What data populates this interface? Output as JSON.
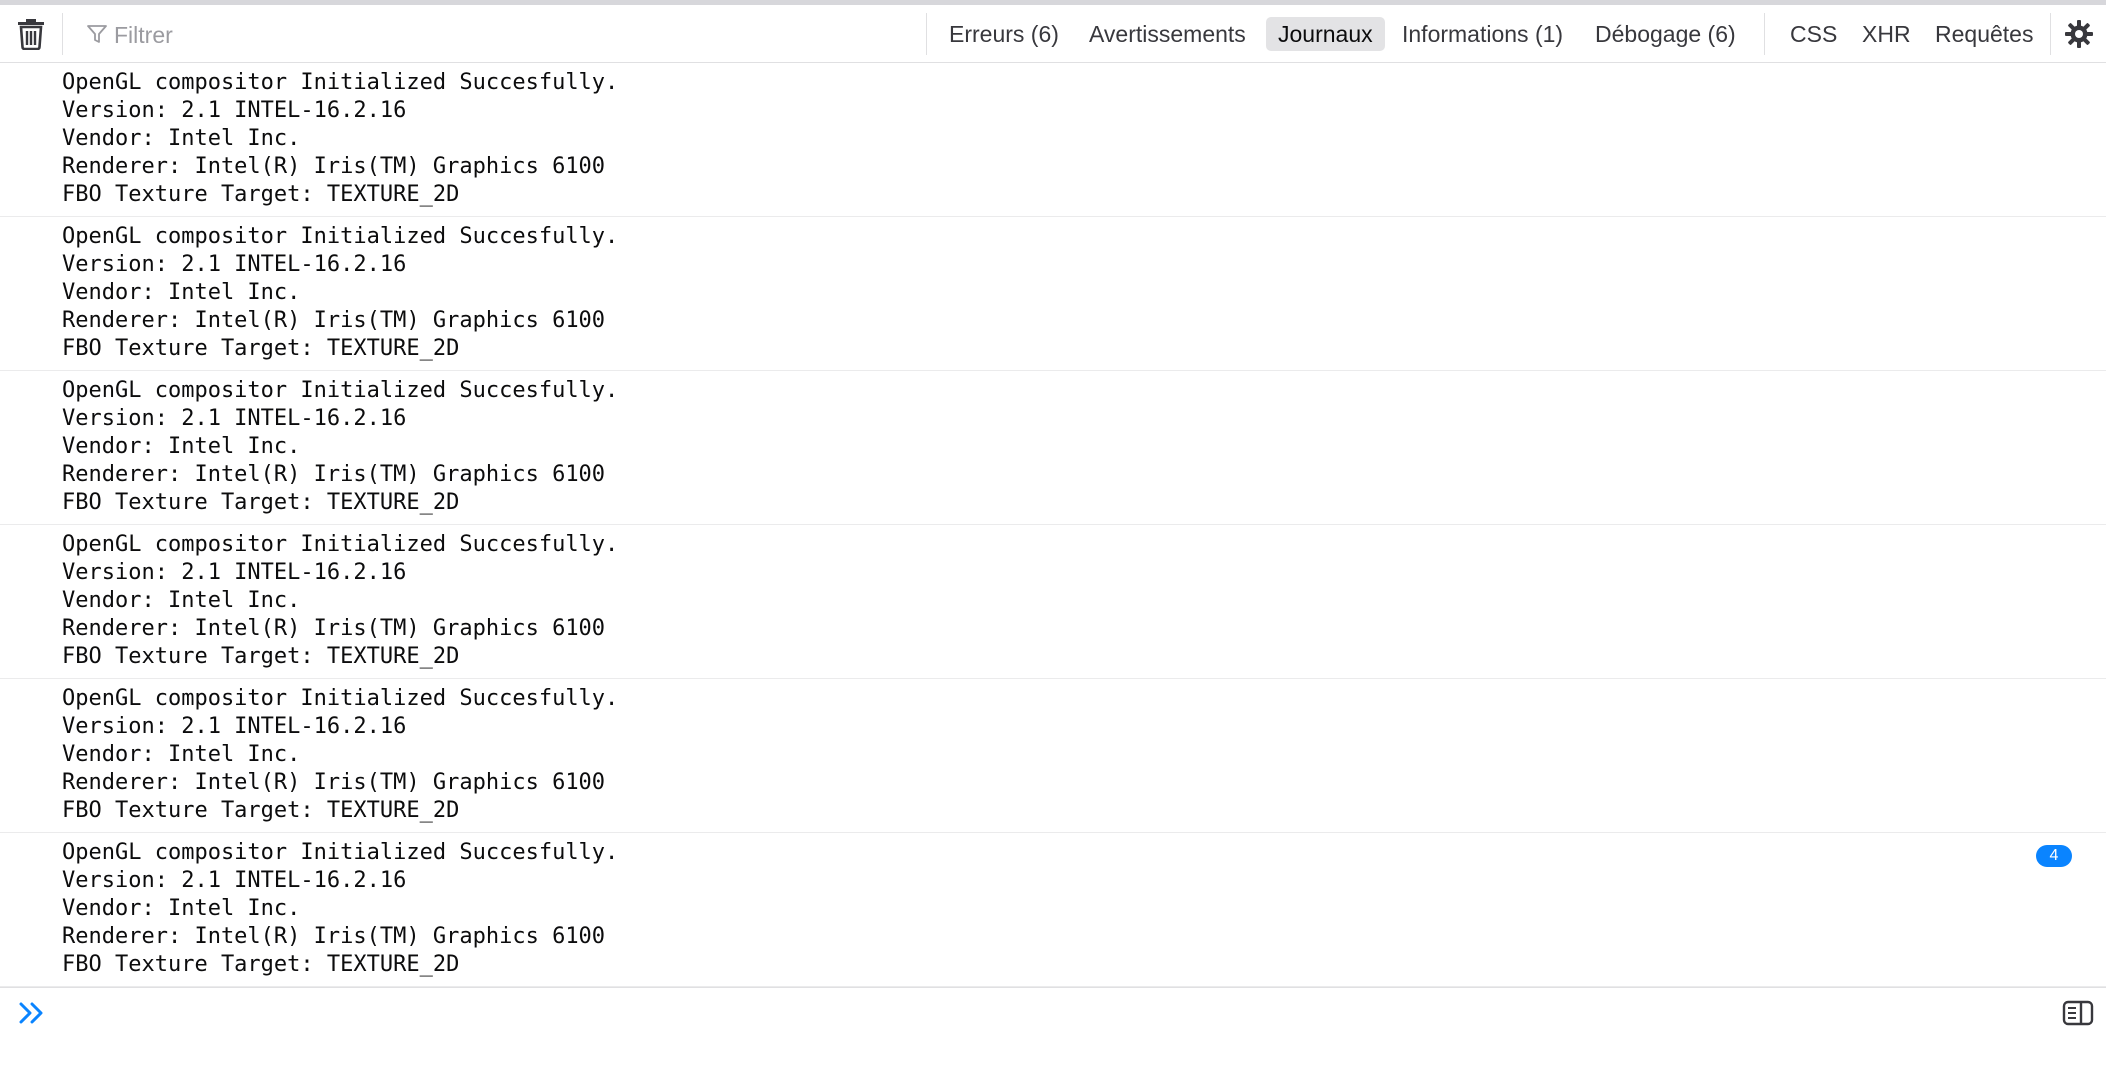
{
  "toolbar": {
    "filter_placeholder": "Filtrer",
    "filters": {
      "errors": "Erreurs (6)",
      "warnings": "Avertissements",
      "logs": "Journaux",
      "info": "Informations (1)",
      "debug": "Débogage (6)"
    },
    "request_filters": {
      "css": "CSS",
      "xhr": "XHR",
      "requests": "Requêtes"
    },
    "active_filter": "logs"
  },
  "messages": [
    {
      "lines": [
        "OpenGL compositor Initialized Succesfully.",
        "Version: 2.1 INTEL-16.2.16",
        "Vendor: Intel Inc.",
        "Renderer: Intel(R) Iris(TM) Graphics 6100",
        "FBO Texture Target: TEXTURE_2D"
      ]
    },
    {
      "lines": [
        "OpenGL compositor Initialized Succesfully.",
        "Version: 2.1 INTEL-16.2.16",
        "Vendor: Intel Inc.",
        "Renderer: Intel(R) Iris(TM) Graphics 6100",
        "FBO Texture Target: TEXTURE_2D"
      ]
    },
    {
      "lines": [
        "OpenGL compositor Initialized Succesfully.",
        "Version: 2.1 INTEL-16.2.16",
        "Vendor: Intel Inc.",
        "Renderer: Intel(R) Iris(TM) Graphics 6100",
        "FBO Texture Target: TEXTURE_2D"
      ]
    },
    {
      "lines": [
        "OpenGL compositor Initialized Succesfully.",
        "Version: 2.1 INTEL-16.2.16",
        "Vendor: Intel Inc.",
        "Renderer: Intel(R) Iris(TM) Graphics 6100",
        "FBO Texture Target: TEXTURE_2D"
      ]
    },
    {
      "lines": [
        "OpenGL compositor Initialized Succesfully.",
        "Version: 2.1 INTEL-16.2.16",
        "Vendor: Intel Inc.",
        "Renderer: Intel(R) Iris(TM) Graphics 6100",
        "FBO Texture Target: TEXTURE_2D"
      ]
    },
    {
      "lines": [
        "OpenGL compositor Initialized Succesfully.",
        "Version: 2.1 INTEL-16.2.16",
        "Vendor: Intel Inc.",
        "Renderer: Intel(R) Iris(TM) Graphics 6100",
        "FBO Texture Target: TEXTURE_2D"
      ],
      "repeat_count": "4"
    }
  ],
  "colors": {
    "accent": "#0a84ff",
    "active_filter_bg": "#e3e3e5",
    "separator": "#e0e0e2"
  },
  "icons": {
    "clear": "trash-icon",
    "filter": "filter-icon",
    "settings": "gear-icon",
    "prompt": "double-chevron-right-icon",
    "sidebar": "sidebar-toggle-icon"
  }
}
